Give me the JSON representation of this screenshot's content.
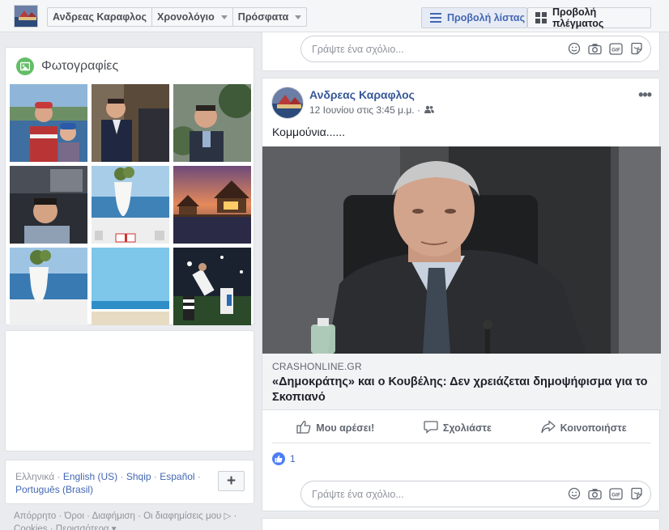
{
  "topbar": {
    "profile_name": "Ανδρεας Καραφλος",
    "timeline_label": "Χρονολόγιο",
    "recent_label": "Πρόσφατα",
    "list_view_label": "Προβολή λίστας",
    "grid_view_label": "Προβολή πλέγματος"
  },
  "photos": {
    "title": "Φωτογραφίες"
  },
  "languages": {
    "current": "Ελληνικά",
    "options": [
      "English (US)",
      "Shqip",
      "Español",
      "Português (Brasil)"
    ]
  },
  "footer": {
    "line1": "Απόρρητο · Όροι · Διαφήμιση · Οι διαφημίσεις μου ▷ ·",
    "line2": "Cookies · Περισσότερα ▾"
  },
  "comment_box": {
    "placeholder": "Γράψτε ένα σχόλιο..."
  },
  "post": {
    "author": "Ανδρεας Καραφλος",
    "timestamp": "12 Ιουνίου στις 3:45 μ.μ. ·",
    "text": "Κομμούνια......",
    "link_domain": "CRASHONLINE.GR",
    "link_title": "«Δημοκράτης» και ο Κουβέλης: Δεν χρειάζεται δημοψήφισμα για το Σκοπιανό",
    "like_label": "Μου αρέσει!",
    "comment_label": "Σχολιάστε",
    "share_label": "Κοινοποιήστε",
    "like_count": "1"
  },
  "colors": {
    "brand_blue": "#4267b2",
    "link_blue": "#365899",
    "background": "#e9ebee",
    "photos_icon_green": "#63be66"
  },
  "icons": {
    "comment_tools": [
      "smile-icon",
      "camera-icon",
      "gif-icon",
      "sticker-icon"
    ]
  }
}
